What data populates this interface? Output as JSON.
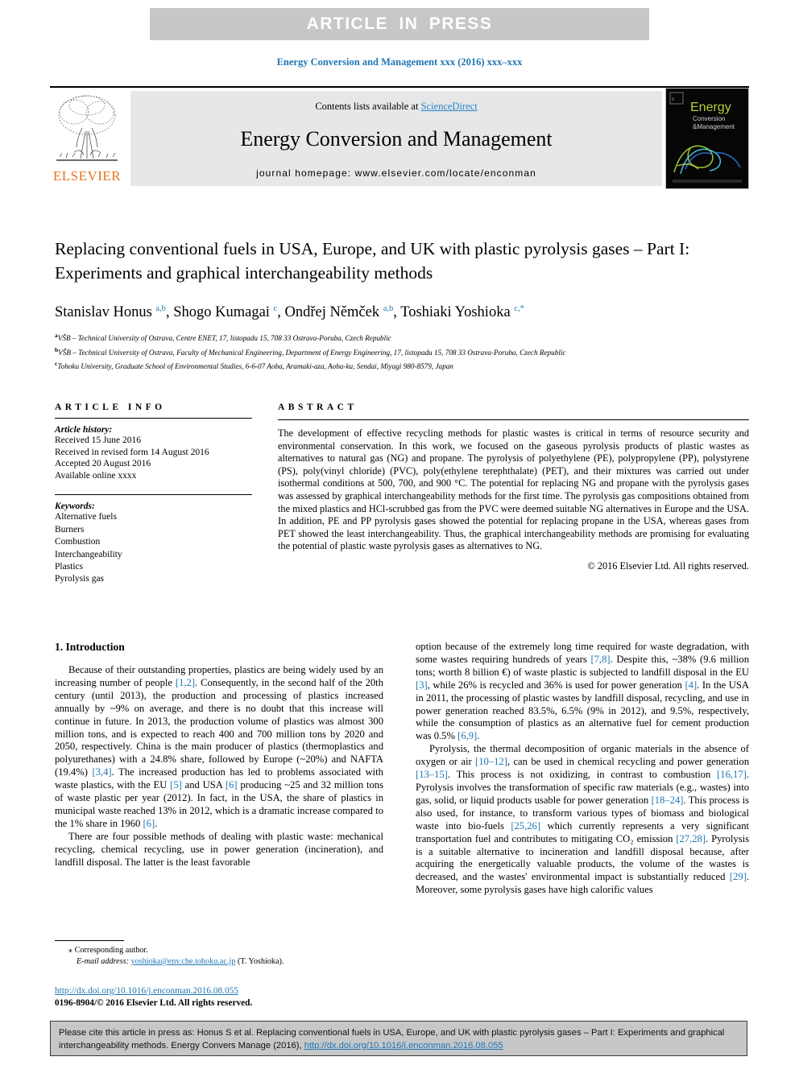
{
  "banner": {
    "text": "ARTICLE  IN  PRESS"
  },
  "running_head": {
    "text": "Energy Conversion and Management xxx (2016) xxx–xxx"
  },
  "masthead": {
    "contents_prefix": "Contents lists available at ",
    "sciencedirect": "ScienceDirect",
    "journal_name": "Energy Conversion and Management",
    "homepage": "journal homepage: www.elsevier.com/locate/enconman",
    "publisher": "ELSEVIER",
    "cover_title": "Energy",
    "cover_sub1": "Conversion",
    "cover_sub2": "&Management"
  },
  "article": {
    "title": "Replacing conventional fuels in USA, Europe, and UK with plastic pyrolysis gases – Part I: Experiments and graphical interchangeability methods",
    "authors": [
      {
        "name": "Stanislav Honus ",
        "sup": "a,b",
        "sep": ", "
      },
      {
        "name": "Shogo Kumagai ",
        "sup": "c",
        "sep": ", "
      },
      {
        "name": "Ondřej Němček ",
        "sup": "a,b",
        "sep": ", "
      },
      {
        "name": "Toshiaki Yoshioka ",
        "sup": "c,*",
        "sep": ""
      }
    ],
    "affiliations": [
      {
        "marker": "a",
        "text": "VŠB – Technical University of Ostrava, Centre ENET, 17, listopadu 15, 708 33 Ostrava-Poruba, Czech Republic"
      },
      {
        "marker": "b",
        "text": "VŠB – Technical University of Ostrava, Faculty of Mechanical Engineering, Department of Energy Engineering, 17, listopadu 15, 708 33 Ostrava-Poruba, Czech Republic"
      },
      {
        "marker": "c",
        "text": "Tohoku University, Graduate School of Environmental Studies, 6-6-07 Aoba, Aramaki-aza, Aoba-ku, Sendai, Miyagi 980-8579, Japan"
      }
    ]
  },
  "article_info": {
    "heading": "ARTICLE INFO",
    "history_label": "Article history:",
    "history": [
      "Received 15 June 2016",
      "Received in revised form 14 August 2016",
      "Accepted 20 August 2016",
      "Available online xxxx"
    ],
    "keywords_label": "Keywords:",
    "keywords": [
      "Alternative fuels",
      "Burners",
      "Combustion",
      "Interchangeability",
      "Plastics",
      "Pyrolysis gas"
    ]
  },
  "abstract": {
    "heading": "ABSTRACT",
    "text": "The development of effective recycling methods for plastic wastes is critical in terms of resource security and environmental conservation. In this work, we focused on the gaseous pyrolysis products of plastic wastes as alternatives to natural gas (NG) and propane. The pyrolysis of polyethylene (PE), polypropylene (PP), polystyrene (PS), poly(vinyl chloride) (PVC), poly(ethylene terephthalate) (PET), and their mixtures was carried out under isothermal conditions at 500, 700, and 900 °C. The potential for replacing NG and propane with the pyrolysis gases was assessed by graphical interchangeability methods for the first time. The pyrolysis gas compositions obtained from the mixed plastics and HCl-scrubbed gas from the PVC were deemed suitable NG alternatives in Europe and the USA. In addition, PE and PP pyrolysis gases showed the potential for replacing propane in the USA, whereas gases from PET showed the least interchangeability. Thus, the graphical interchangeability methods are promising for evaluating the potential of plastic waste pyrolysis gases as alternatives to NG.",
    "copyright": "© 2016 Elsevier Ltd. All rights reserved."
  },
  "introduction": {
    "heading": "1. Introduction",
    "left_paragraphs": [
      "Because of their outstanding properties, plastics are being widely used by an increasing number of people [1,2]. Consequently, in the second half of the 20th century (until 2013), the production and processing of plastics increased annually by ~9% on average, and there is no doubt that this increase will continue in future. In 2013, the production volume of plastics was almost 300 million tons, and is expected to reach 400 and 700 million tons by 2020 and 2050, respectively. China is the main producer of plastics (thermoplastics and polyurethanes) with a 24.8% share, followed by Europe (~20%) and NAFTA (19.4%) [3,4]. The increased production has led to problems associated with waste plastics, with the EU [5] and USA [6] producing ~25 and 32 million tons of waste plastic per year (2012). In fact, in the USA, the share of plastics in municipal waste reached 13% in 2012, which is a dramatic increase compared to the 1% share in 1960 [6].",
      "There are four possible methods of dealing with plastic waste: mechanical recycling, chemical recycling, use in power generation (incineration), and landfill disposal. The latter is the least favorable"
    ],
    "right_paragraphs": [
      "option because of the extremely long time required for waste degradation, with some wastes requiring hundreds of years [7,8]. Despite this, ~38% (9.6 million tons; worth 8 billion €) of waste plastic is subjected to landfill disposal in the EU [3], while 26% is recycled and 36% is used for power generation [4]. In the USA in 2011, the processing of plastic wastes by landfill disposal, recycling, and use in power generation reached 83.5%, 6.5% (9% in 2012), and 9.5%, respectively, while the consumption of plastics as an alternative fuel for cement production was 0.5% [6,9].",
      "Pyrolysis, the thermal decomposition of organic materials in the absence of oxygen or air [10–12], can be used in chemical recycling and power generation [13–15]. This process is not oxidizing, in contrast to combustion [16,17]. Pyrolysis involves the transformation of specific raw materials (e.g., wastes) into gas, solid, or liquid products usable for power generation [18–24]. This process is also used, for instance, to transform various types of biomass and biological waste into bio-fuels [25,26] which currently represents a very significant transportation fuel and contributes to mitigating CO₂ emission [27,28]. Pyrolysis is a suitable alternative to incineration and landfill disposal because, after acquiring the energetically valuable products, the volume of the wastes is decreased, and the wastes' environmental impact is substantially reduced [29]. Moreover, some pyrolysis gases have high calorific values"
    ]
  },
  "footnote": {
    "corresponding": "Corresponding author.",
    "email_label": "E-mail address:",
    "email": "yoshioka@env.che.tohoku.ac.jp",
    "email_owner": "(T. Yoshioka)."
  },
  "doi_block": {
    "doi": "http://dx.doi.org/10.1016/j.enconman.2016.08.055",
    "issn": "0196-8904/© 2016 Elsevier Ltd. All rights reserved."
  },
  "citation_footer": {
    "text_before": "Please cite this article in press as: Honus S et al. Replacing conventional fuels in USA, Europe, and UK with plastic pyrolysis gases – Part I: Experiments and graphical interchangeability methods. Energy Convers Manage (2016), ",
    "link": "http://dx.doi.org/10.1016/j.enconman.2016.08.055"
  },
  "colors": {
    "link_blue": "#1f76b4",
    "sciencedirect_blue": "#2a84c7",
    "elsevier_orange": "#e9711c",
    "banner_gray": "#c6c7c9",
    "band_gray": "#e6e7e8"
  }
}
